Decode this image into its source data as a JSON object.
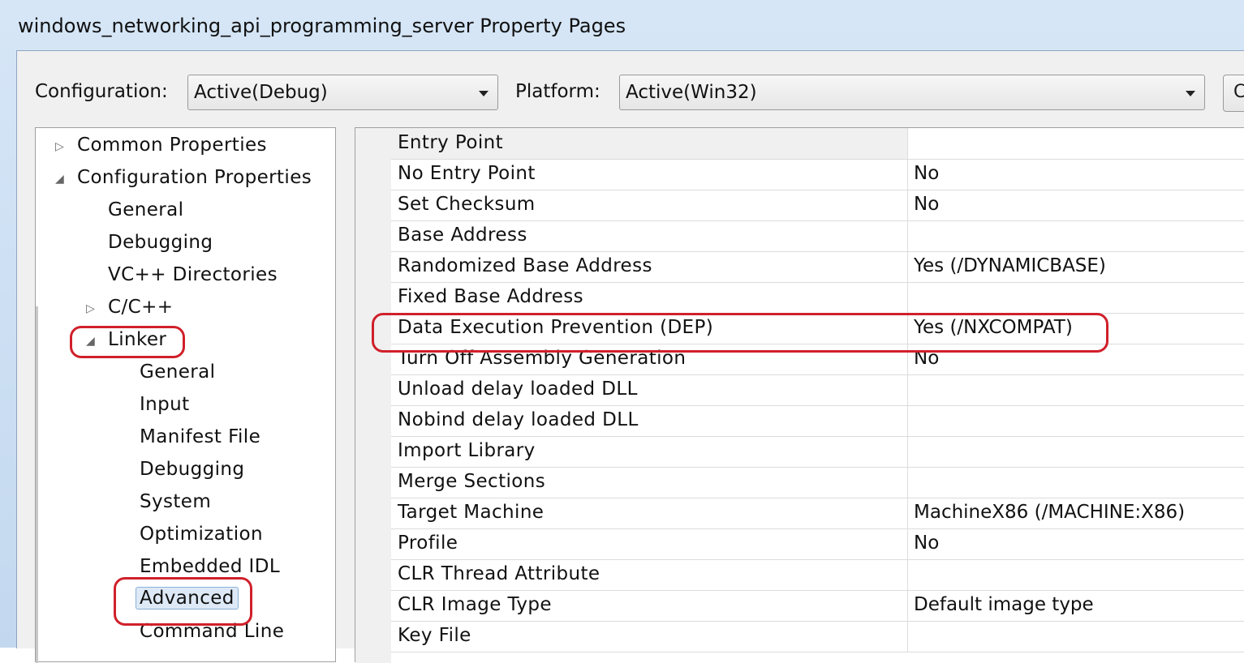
{
  "window": {
    "title": "windows_networking_api_programming_server Property Pages"
  },
  "config": {
    "configuration_label": "Configuration:",
    "configuration_value": "Active(Debug)",
    "platform_label": "Platform:",
    "platform_value": "Active(Win32)",
    "edge_button": "C"
  },
  "tree": {
    "common": "Common Properties",
    "config_props": "Configuration Properties",
    "general": "General",
    "debugging": "Debugging",
    "vcpp": "VC++ Directories",
    "cpp": "C/C++",
    "linker": "Linker",
    "linker_items": [
      "General",
      "Input",
      "Manifest File",
      "Debugging",
      "System",
      "Optimization",
      "Embedded IDL",
      "Advanced",
      "Command Line"
    ],
    "selected": "Advanced"
  },
  "grid": {
    "rows": [
      {
        "name": "Entry Point",
        "value": ""
      },
      {
        "name": "No Entry Point",
        "value": "No"
      },
      {
        "name": "Set Checksum",
        "value": "No"
      },
      {
        "name": "Base Address",
        "value": ""
      },
      {
        "name": "Randomized Base Address",
        "value": "Yes (/DYNAMICBASE)"
      },
      {
        "name": "Fixed Base Address",
        "value": ""
      },
      {
        "name": "Data Execution Prevention (DEP)",
        "value": "Yes (/NXCOMPAT)"
      },
      {
        "name": "Turn Off Assembly Generation",
        "value": "No"
      },
      {
        "name": "Unload delay loaded DLL",
        "value": ""
      },
      {
        "name": "Nobind delay loaded DLL",
        "value": ""
      },
      {
        "name": "Import Library",
        "value": ""
      },
      {
        "name": "Merge Sections",
        "value": ""
      },
      {
        "name": "Target Machine",
        "value": "MachineX86 (/MACHINE:X86)"
      },
      {
        "name": "Profile",
        "value": "No"
      },
      {
        "name": "CLR Thread Attribute",
        "value": ""
      },
      {
        "name": "CLR Image Type",
        "value": "Default image type"
      },
      {
        "name": "Key File",
        "value": ""
      }
    ]
  },
  "colors": {
    "annotation": "#d0202a",
    "selection": "#dde9f6"
  }
}
